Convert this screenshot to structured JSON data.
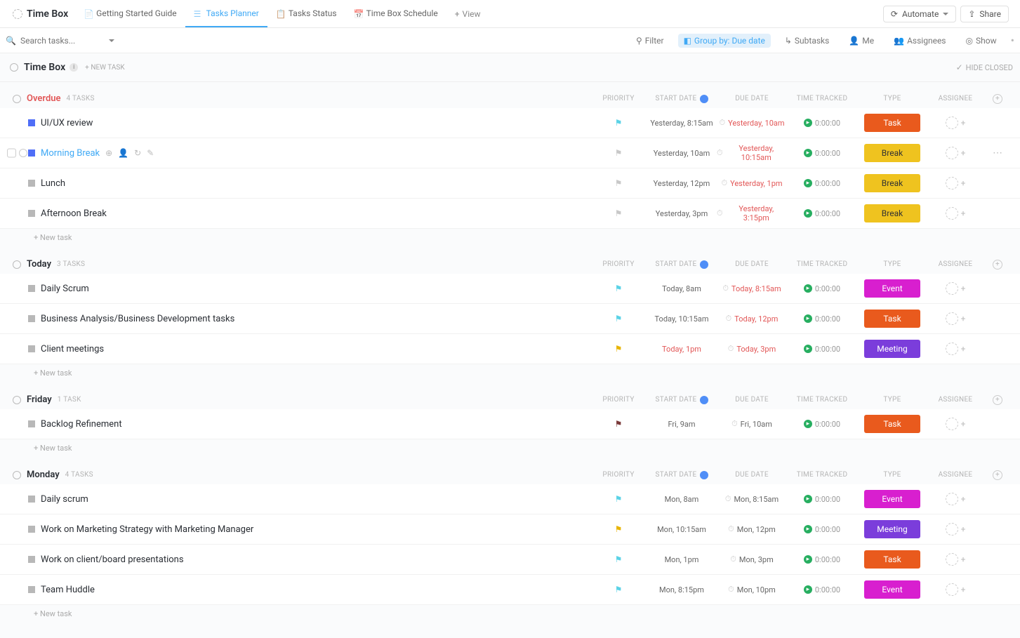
{
  "header": {
    "title": "Time Box",
    "tabs": [
      {
        "label": "Getting Started Guide",
        "active": false
      },
      {
        "label": "Tasks Planner",
        "active": true
      },
      {
        "label": "Tasks Status",
        "active": false
      },
      {
        "label": "Time Box Schedule",
        "active": false
      }
    ],
    "add_view": "View",
    "automate": "Automate",
    "share": "Share"
  },
  "toolbar": {
    "search_placeholder": "Search tasks...",
    "filter": "Filter",
    "group": "Group by: Due date",
    "subtasks": "Subtasks",
    "me": "Me",
    "assignees": "Assignees",
    "show": "Show"
  },
  "list_header": {
    "title": "Time Box",
    "new_task": "+ NEW TASK",
    "hide_closed": "HIDE CLOSED"
  },
  "columns": {
    "priority": "PRIORITY",
    "start": "START DATE",
    "due": "DUE DATE",
    "tracked": "TIME TRACKED",
    "type": "TYPE",
    "assignee": "ASSIGNEE"
  },
  "new_task_label": "+ New task",
  "groups": [
    {
      "name": "Overdue",
      "color": "#e25757",
      "count": "4 TASKS",
      "tasks": [
        {
          "name": "UI/UX review",
          "status": "blue",
          "flag": "cyan",
          "start": "Yesterday, 8:15am",
          "due": "Yesterday, 10am",
          "due_red": true,
          "tracked": "0:00:00",
          "type": "Task"
        },
        {
          "name": "Morning Break",
          "status": "blue",
          "flag": "grey",
          "start": "Yesterday, 10am",
          "due": "Yesterday, 10:15am",
          "due_red": true,
          "tracked": "0:00:00",
          "type": "Break",
          "hovered": true,
          "link": true,
          "extra": "⋯"
        },
        {
          "name": "Lunch",
          "status": "grey",
          "flag": "grey",
          "start": "Yesterday, 12pm",
          "due": "Yesterday, 1pm",
          "due_red": true,
          "tracked": "0:00:00",
          "type": "Break"
        },
        {
          "name": "Afternoon Break",
          "status": "grey",
          "flag": "grey",
          "start": "Yesterday, 3pm",
          "due": "Yesterday, 3:15pm",
          "due_red": true,
          "tracked": "0:00:00",
          "type": "Break"
        }
      ]
    },
    {
      "name": "Today",
      "color": "#2a2e34",
      "count": "3 TASKS",
      "tasks": [
        {
          "name": "Daily Scrum",
          "status": "grey",
          "flag": "cyan",
          "start": "Today, 8am",
          "due": "Today, 8:15am",
          "due_red": true,
          "tracked": "0:00:00",
          "type": "Event"
        },
        {
          "name": "Business Analysis/Business Development tasks",
          "status": "grey",
          "flag": "cyan",
          "start": "Today, 10:15am",
          "due": "Today, 12pm",
          "due_red": true,
          "tracked": "0:00:00",
          "type": "Task"
        },
        {
          "name": "Client meetings",
          "status": "grey",
          "flag": "yellow",
          "start": "Today, 1pm",
          "start_red": true,
          "due": "Today, 3pm",
          "due_red": true,
          "tracked": "0:00:00",
          "type": "Meeting"
        }
      ]
    },
    {
      "name": "Friday",
      "color": "#2a2e34",
      "count": "1 TASK",
      "tasks": [
        {
          "name": "Backlog Refinement",
          "status": "grey",
          "flag": "maroon",
          "start": "Fri, 9am",
          "due": "Fri, 10am",
          "tracked": "0:00:00",
          "type": "Task"
        }
      ]
    },
    {
      "name": "Monday",
      "color": "#2a2e34",
      "count": "4 TASKS",
      "tasks": [
        {
          "name": "Daily scrum",
          "status": "grey",
          "flag": "cyan",
          "start": "Mon, 8am",
          "due": "Mon, 8:15am",
          "tracked": "0:00:00",
          "type": "Event"
        },
        {
          "name": "Work on Marketing Strategy with Marketing Manager",
          "status": "grey",
          "flag": "yellow",
          "start": "Mon, 10:15am",
          "due": "Mon, 12pm",
          "tracked": "0:00:00",
          "type": "Meeting"
        },
        {
          "name": "Work on client/board presentations",
          "status": "grey",
          "flag": "cyan",
          "start": "Mon, 1pm",
          "due": "Mon, 3pm",
          "tracked": "0:00:00",
          "type": "Task"
        },
        {
          "name": "Team Huddle",
          "status": "grey",
          "flag": "cyan",
          "start": "Mon, 8:15pm",
          "due": "Mon, 10pm",
          "tracked": "0:00:00",
          "type": "Event"
        }
      ]
    }
  ]
}
